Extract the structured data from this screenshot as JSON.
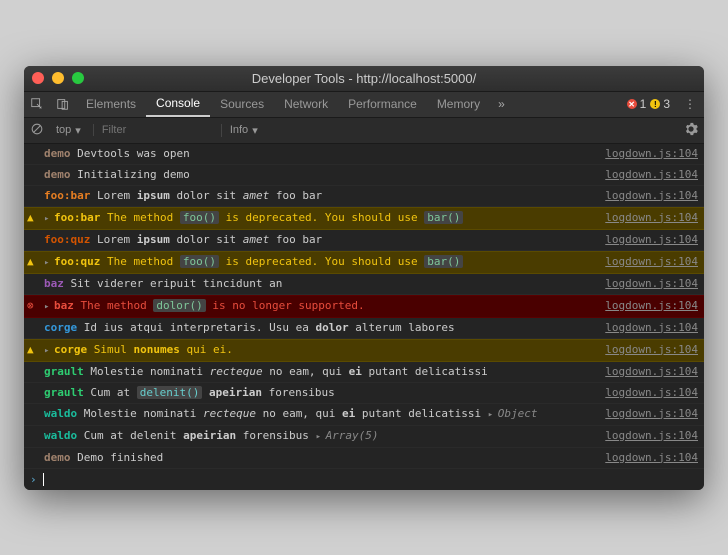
{
  "window": {
    "title": "Developer Tools - http://localhost:5000/"
  },
  "tabs": {
    "items": [
      "Elements",
      "Console",
      "Sources",
      "Network",
      "Performance",
      "Memory"
    ],
    "active": "Console",
    "more_glyph": "»"
  },
  "badges": {
    "errors": "1",
    "warnings": "3"
  },
  "menu_dots": "⋮",
  "filter": {
    "context": "top",
    "placeholder": "Filter",
    "level": "Info",
    "dropdown_glyph": "▾"
  },
  "source_ref": "logdown.js:104",
  "logs": [
    {
      "type": "log",
      "prefix": "demo",
      "prefixClass": "p-demo",
      "html": "Devtools was open"
    },
    {
      "type": "log",
      "prefix": "demo",
      "prefixClass": "p-demo",
      "html": "Initializing demo"
    },
    {
      "type": "log",
      "prefix": "foo:bar",
      "prefixClass": "p-foobar",
      "html": "Lorem <span class='bold'>ipsum</span> dolor sit <span class='em'>amet</span> foo bar"
    },
    {
      "type": "warn",
      "prefix": "foo:bar",
      "prefixClass": "p-foobar",
      "expand": true,
      "html": "The method <span class='hl fn'>foo()</span> is deprecated. You should use <span class='hl fn'>bar()</span>"
    },
    {
      "type": "log",
      "prefix": "foo:quz",
      "prefixClass": "p-fooquz",
      "html": "Lorem <span class='bold'>ipsum</span> dolor sit <span class='em'>amet</span> foo bar"
    },
    {
      "type": "warn",
      "prefix": "foo:quz",
      "prefixClass": "p-fooquz",
      "expand": true,
      "html": "The method <span class='hl fn'>foo()</span> is deprecated. You should use <span class='hl fn'>bar()</span>"
    },
    {
      "type": "log",
      "prefix": "baz",
      "prefixClass": "p-baz",
      "html": "Sit viderer eripuit tincidunt an"
    },
    {
      "type": "error",
      "prefix": "baz",
      "prefixClass": "p-baz",
      "expand": true,
      "html": "The method <span class='hl fn'>dolor()</span> is no longer supported."
    },
    {
      "type": "log",
      "prefix": "corge",
      "prefixClass": "p-corge",
      "html": "Id ius atqui interpretaris. Usu ea <span class='bold'>dolor</span> alterum labores"
    },
    {
      "type": "warn",
      "prefix": "corge",
      "prefixClass": "p-corge",
      "expand": true,
      "html": "Simul <span class='bold'>nonumes</span> qui ei."
    },
    {
      "type": "log",
      "prefix": "grault",
      "prefixClass": "p-grault",
      "html": "Molestie nominati <span class='em'>recteque</span> no eam, qui <span class='bold'>ei</span> putant delicatissi"
    },
    {
      "type": "log",
      "prefix": "grault",
      "prefixClass": "p-grault",
      "html": "Cum at <span class='hl'>delenit()</span> <span class='bold'>apeirian</span> forensibus"
    },
    {
      "type": "log",
      "prefix": "waldo",
      "prefixClass": "p-waldo",
      "html": "Molestie nominati <span class='em'>recteque</span> no eam, qui <span class='bold'>ei</span> putant delicatissi <span class='expand'>▸</span><span class='obj'>Object</span>"
    },
    {
      "type": "log",
      "prefix": "waldo",
      "prefixClass": "p-waldo",
      "html": "Cum at delenit <span class='bold'>apeirian</span> forensibus <span class='expand'>▸</span><span class='obj'>Array(5)</span>"
    },
    {
      "type": "log",
      "prefix": "demo",
      "prefixClass": "p-demo",
      "html": "Demo finished"
    }
  ],
  "prompt_caret": "›"
}
